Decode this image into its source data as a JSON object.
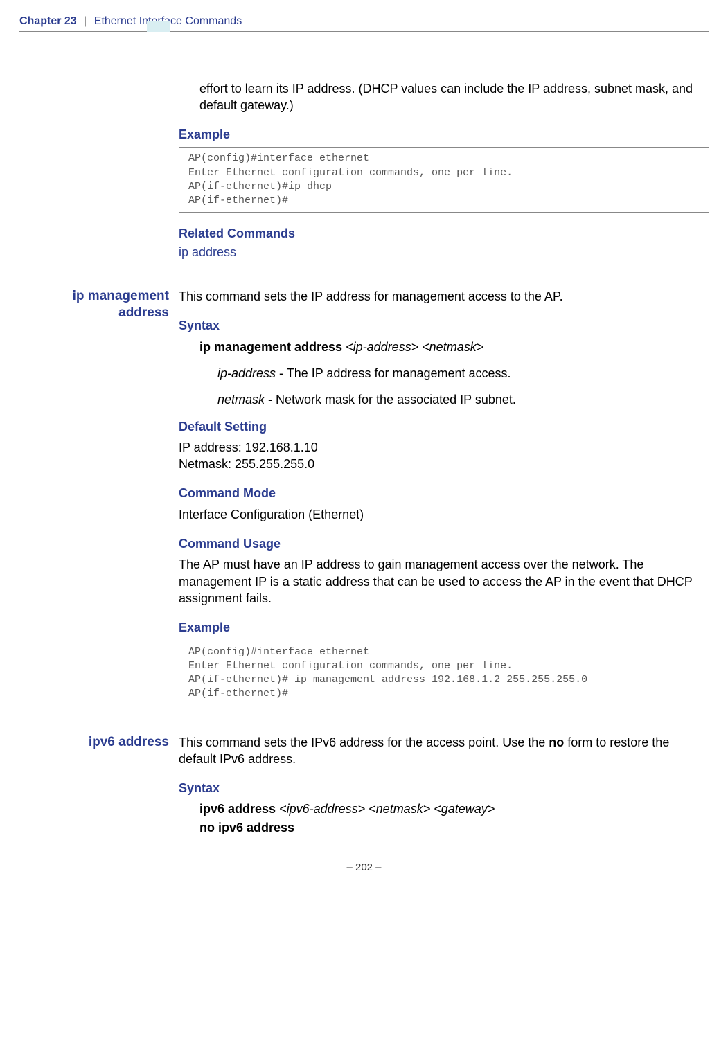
{
  "header": {
    "chapter": "Chapter 23",
    "title": "Ethernet Interface Commands"
  },
  "intro_text": "effort to learn its IP address. (DHCP values can include the IP address, subnet mask, and default gateway.)",
  "example1": {
    "heading": "Example",
    "code": "AP(config)#interface ethernet\nEnter Ethernet configuration commands, one per line.\nAP(if-ethernet)#ip dhcp\nAP(if-ethernet)#"
  },
  "related": {
    "heading": "Related Commands",
    "link": "ip address"
  },
  "ip_mgmt": {
    "sidebar_l1": "ip management",
    "sidebar_l2": "address",
    "desc": "This command sets the IP address for management access to the AP.",
    "syntax_heading": "Syntax",
    "syntax_cmd_bold": "ip management address",
    "syntax_cmd_args": "<ip-address> <netmask>",
    "param1_name": "ip-address",
    "param1_desc": " - The IP address for management access.",
    "param2_name": "netmask",
    "param2_desc": " - Network mask for the associated IP subnet.",
    "default_heading": "Default Setting",
    "default_l1": "IP address: 192.168.1.10",
    "default_l2": "Netmask: 255.255.255.0",
    "mode_heading": "Command Mode",
    "mode_text": "Interface Configuration (Ethernet)",
    "usage_heading": "Command Usage",
    "usage_text": "The AP must have an IP address to gain management access over the network. The management IP is a static address that can be used to access the AP in the event that DHCP assignment fails.",
    "example_heading": "Example",
    "example_code": "AP(config)#interface ethernet\nEnter Ethernet configuration commands, one per line.\nAP(if-ethernet)# ip management address 192.168.1.2 255.255.255.0\nAP(if-ethernet)#"
  },
  "ipv6": {
    "sidebar": "ipv6 address",
    "desc_p1": "This command sets the IPv6 address for the access point. Use the ",
    "desc_bold": "no",
    "desc_p2": " form to restore the default IPv6 address.",
    "syntax_heading": "Syntax",
    "syntax_l1_bold": "ipv6 address",
    "syntax_l1_args": "<ipv6-address> <netmask> <gateway>",
    "syntax_l2": "no ipv6 address"
  },
  "footer": "–  202  –"
}
